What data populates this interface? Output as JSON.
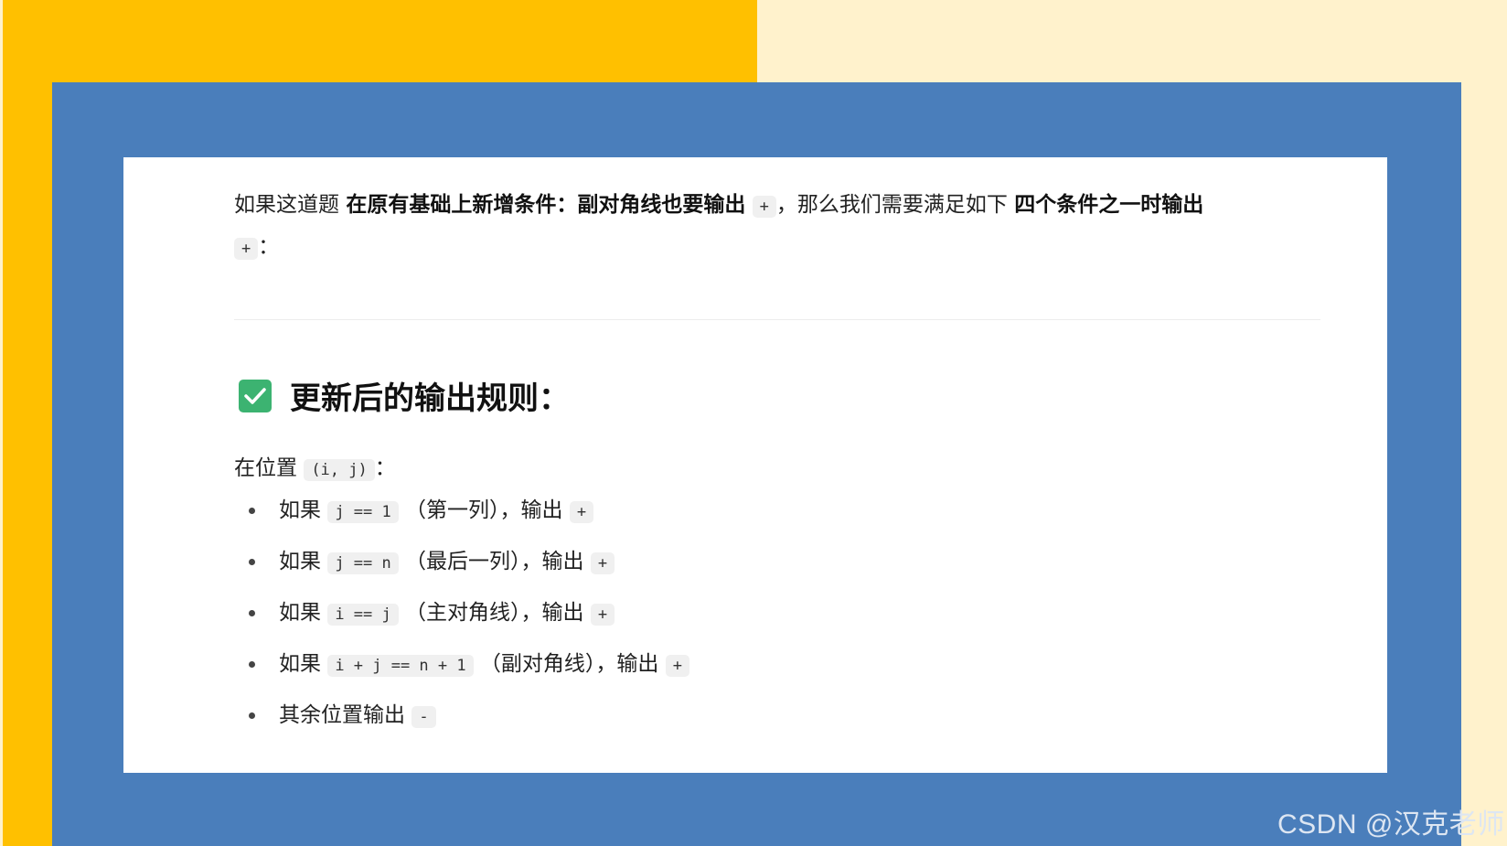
{
  "paragraph": {
    "t1": "如果这道题 ",
    "b1": "在原有基础上新增条件：副对角线也要输出",
    "c1": "+",
    "t2": "，那么我们需要满足如下 ",
    "b2": "四个条件之一时输出",
    "c2": "+",
    "t3": "："
  },
  "section": {
    "heading": "更新后的输出规则：",
    "icon": "check-mark-icon",
    "intro_text": "在位置",
    "intro_code": "(i, j)",
    "intro_colon": "："
  },
  "rules": [
    {
      "pre": "如果",
      "code": "j == 1",
      "desc": "（第一列），输出",
      "out": "+"
    },
    {
      "pre": "如果",
      "code": "j == n",
      "desc": "（最后一列），输出",
      "out": "+"
    },
    {
      "pre": "如果",
      "code": "i == j",
      "desc": "（主对角线），输出",
      "out": "+"
    },
    {
      "pre": "如果",
      "code": "i + j == n + 1",
      "desc": "（副对角线），输出",
      "out": "+"
    },
    {
      "pre": "其余位置输出",
      "code": "",
      "desc": "",
      "out": "-"
    }
  ],
  "watermark": "CSDN @汉克老师",
  "colors": {
    "yellow": "#FFC000",
    "cream": "#FFF2CC",
    "blue": "#4A7EBB",
    "check": "#3CB371"
  }
}
